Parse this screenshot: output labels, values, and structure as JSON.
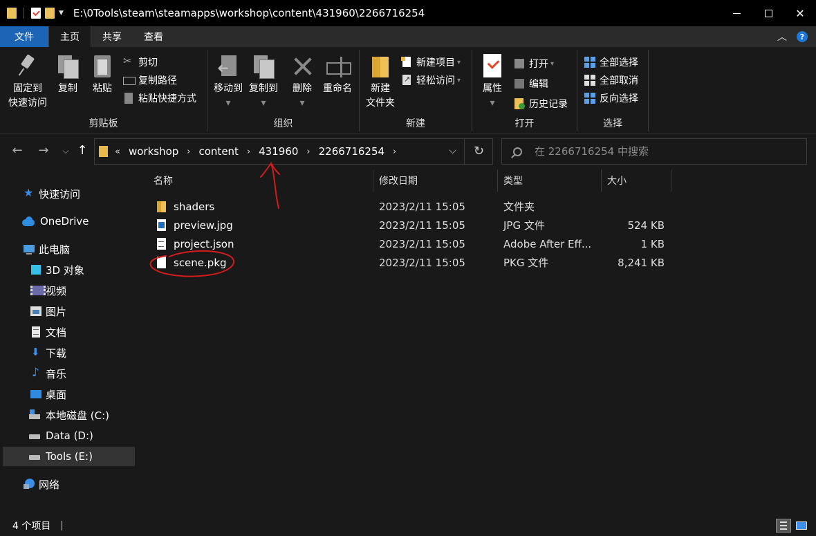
{
  "window": {
    "title": "E:\\0Tools\\steam\\steamapps\\workshop\\content\\431960\\2266716254",
    "minimize_label": "—",
    "close_label": "✕"
  },
  "ribbon_tabs": [
    "文件",
    "主页",
    "共享",
    "查看"
  ],
  "help": {
    "label": "?"
  },
  "ribbon": {
    "clipboard": {
      "label": "剪贴板",
      "pin_line1": "固定到",
      "pin_line2": "快速访问",
      "copy": "复制",
      "paste": "粘贴",
      "cut": "剪切",
      "copy_path": "复制路径",
      "paste_shortcut": "粘贴快捷方式"
    },
    "organize": {
      "label": "组织",
      "move_to": "移动到",
      "copy_to": "复制到",
      "delete": "删除",
      "rename": "重命名"
    },
    "new": {
      "label": "新建",
      "new_folder_line1": "新建",
      "new_folder_line2": "文件夹",
      "new_item": "新建项目",
      "easy_access": "轻松访问"
    },
    "open": {
      "label": "打开",
      "properties": "属性",
      "open": "打开",
      "edit": "编辑",
      "history": "历史记录"
    },
    "select": {
      "label": "选择",
      "select_all": "全部选择",
      "select_none": "全部取消",
      "invert": "反向选择"
    }
  },
  "address": {
    "prefix": "«",
    "crumbs": [
      "workshop",
      "content",
      "431960",
      "2266716254"
    ]
  },
  "search": {
    "placeholder": "在 2266716254 中搜索"
  },
  "sidebar": {
    "items": [
      {
        "label": "快速访问",
        "icon": "star-icon"
      },
      {
        "label": "OneDrive",
        "icon": "cloud-icon"
      },
      {
        "label": "此电脑",
        "icon": "computer-icon"
      },
      {
        "label": "3D 对象",
        "icon": "cube-icon"
      },
      {
        "label": "视频",
        "icon": "video-icon"
      },
      {
        "label": "图片",
        "icon": "picture-icon"
      },
      {
        "label": "文档",
        "icon": "document-icon"
      },
      {
        "label": "下载",
        "icon": "download-icon"
      },
      {
        "label": "音乐",
        "icon": "music-icon"
      },
      {
        "label": "桌面",
        "icon": "desktop-icon"
      },
      {
        "label": "本地磁盘 (C:)",
        "icon": "drive-icon"
      },
      {
        "label": "Data (D:)",
        "icon": "drive-icon"
      },
      {
        "label": "Tools (E:)",
        "icon": "drive-icon",
        "selected": true
      },
      {
        "label": "网络",
        "icon": "network-icon"
      }
    ]
  },
  "columns": {
    "name": "名称",
    "date": "修改日期",
    "type": "类型",
    "size": "大小"
  },
  "files": [
    {
      "name": "shaders",
      "date": "2023/2/11 15:05",
      "type": "文件夹",
      "size": "",
      "icon": "folder-icon"
    },
    {
      "name": "preview.jpg",
      "date": "2023/2/11 15:05",
      "type": "JPG 文件",
      "size": "524 KB",
      "icon": "jpg-file-icon"
    },
    {
      "name": "project.json",
      "date": "2023/2/11 15:05",
      "type": "Adobe After Eff...",
      "size": "1 KB",
      "icon": "json-file-icon"
    },
    {
      "name": "scene.pkg",
      "date": "2023/2/11 15:05",
      "type": "PKG 文件",
      "size": "8,241 KB",
      "icon": "pkg-file-icon"
    }
  ],
  "status": {
    "item_count": "4 个项目"
  },
  "colors": {
    "accent": "#1b64b6",
    "annotation": "#d21c1c",
    "background": "#191919"
  }
}
